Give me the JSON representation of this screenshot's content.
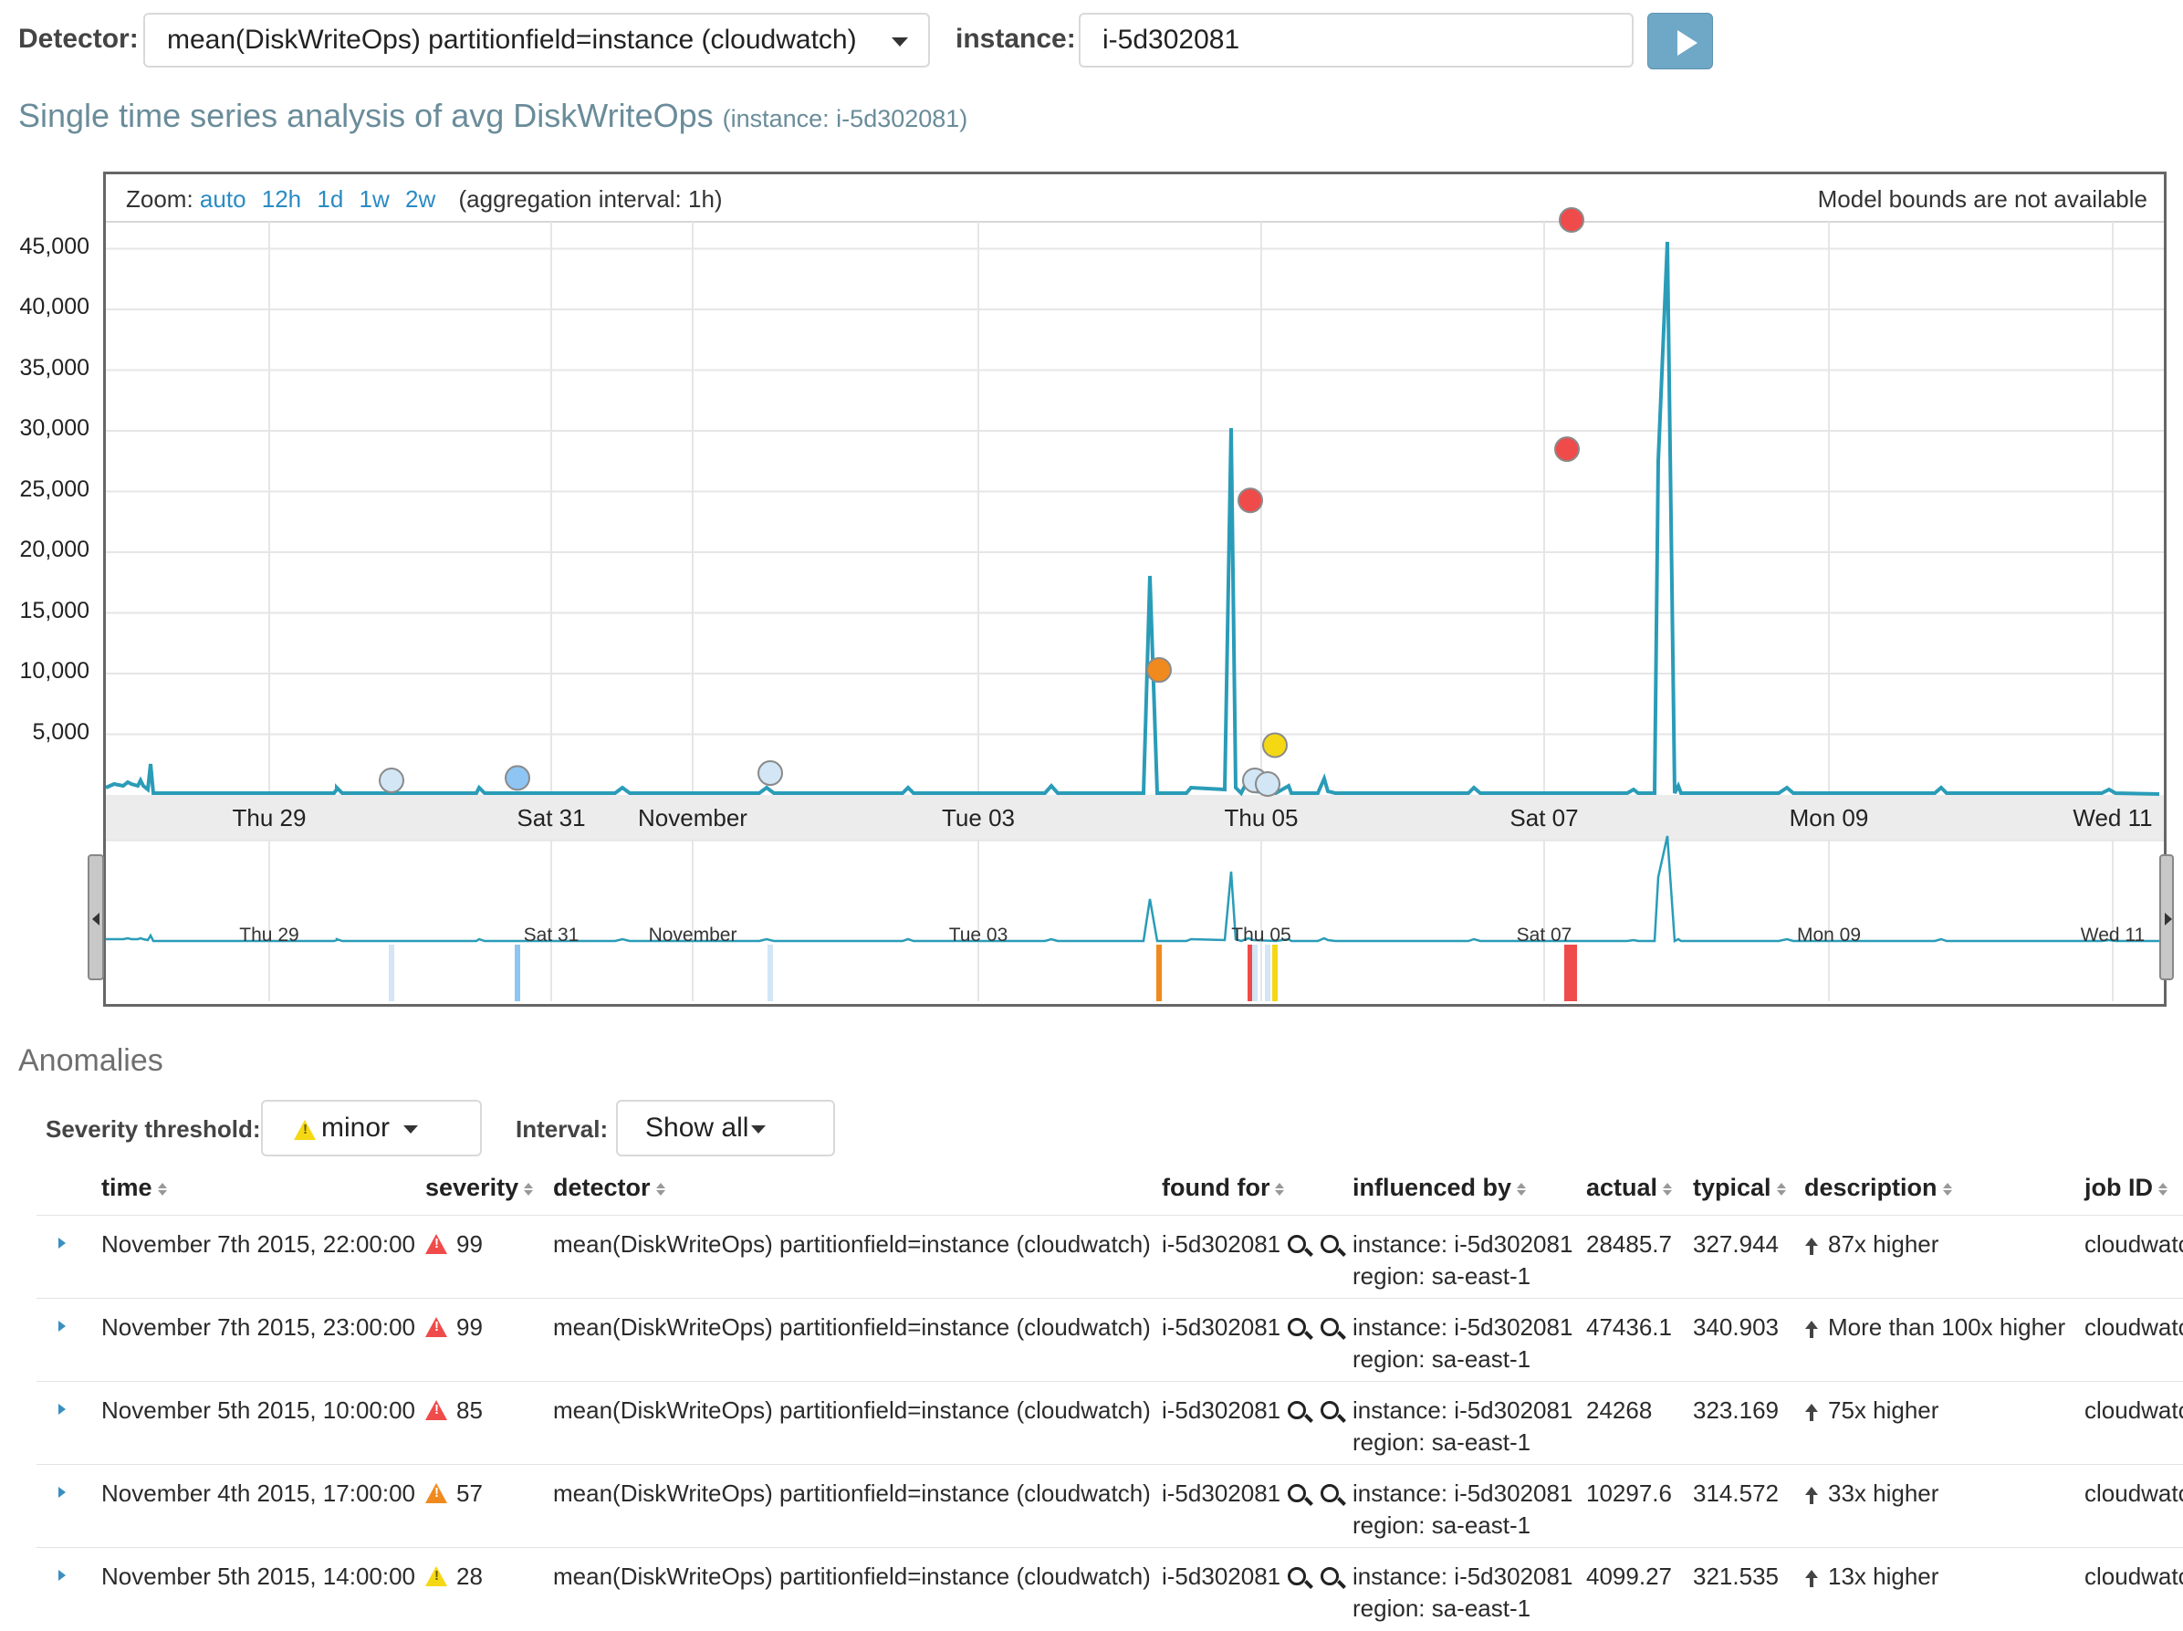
{
  "toolbar": {
    "detector_label": "Detector:",
    "detector_value": "mean(DiskWriteOps) partitionfield=instance (cloudwatch)",
    "instance_label": "instance:",
    "instance_value": "i-5d302081"
  },
  "title": {
    "main": "Single time series analysis of avg DiskWriteOps",
    "sub": "(instance: i-5d302081)"
  },
  "chart_header": {
    "zoom_label": "Zoom:",
    "zoom_options": [
      "auto",
      "12h",
      "1d",
      "1w",
      "2w"
    ],
    "aggregation": "(aggregation interval: 1h)",
    "model_bounds": "Model bounds are not available"
  },
  "colors": {
    "line": "#2a9cb8",
    "critical": "#f04b4b",
    "major": "#f08a1e",
    "minor": "#f5d814",
    "warning": "#8ec5f2",
    "low": "#d2e6f5",
    "link": "#2a8bc4"
  },
  "chart_data": {
    "type": "line",
    "ylim": [
      0,
      46000
    ],
    "yticks": [
      "5,000",
      "10,000",
      "15,000",
      "20,000",
      "25,000",
      "30,000",
      "35,000",
      "40,000",
      "45,000"
    ],
    "xticks": [
      "Thu 29",
      "Sat 31",
      "November",
      "Tue 03",
      "Thu 05",
      "Sat 07",
      "Mon 09",
      "Wed 11"
    ],
    "anomalies_markers": [
      {
        "x": 4.5,
        "y": 1200,
        "severity": "low"
      },
      {
        "x": 15.5,
        "y": 1400,
        "severity": "warning"
      },
      {
        "x": 36.0,
        "y": 1800,
        "severity": "low"
      },
      {
        "x": 59.0,
        "y": 10297.6,
        "severity": "major"
      },
      {
        "x": 64.0,
        "y": 24268,
        "severity": "critical"
      },
      {
        "x": 64.3,
        "y": 1200,
        "severity": "low"
      },
      {
        "x": 64.6,
        "y": 900,
        "severity": "low"
      },
      {
        "x": 65.0,
        "y": 4099.27,
        "severity": "minor"
      },
      {
        "x": 69.0,
        "y": 28485.7,
        "severity": "critical"
      },
      {
        "x": 70.0,
        "y": 47436.1,
        "severity": "critical"
      }
    ]
  },
  "anomalies": {
    "title": "Anomalies",
    "severity_label": "Severity threshold:",
    "severity_value": "minor",
    "interval_label": "Interval:",
    "interval_value": "Show all",
    "columns": [
      "time",
      "severity",
      "detector",
      "found for",
      "influenced by",
      "actual",
      "typical",
      "description",
      "job ID"
    ],
    "rows": [
      {
        "time": "November 7th 2015, 22:00:00",
        "severity": "99",
        "level": "critical",
        "detector": "mean(DiskWriteOps) partitionfield=instance (cloudwatch)",
        "found_for": "i-5d302081",
        "influenced_1": "instance: i-5d302081",
        "influenced_2": "region: sa-east-1",
        "actual": "28485.7",
        "typical": "327.944",
        "description": "87x higher",
        "job_id": "cloudwatch"
      },
      {
        "time": "November 7th 2015, 23:00:00",
        "severity": "99",
        "level": "critical",
        "detector": "mean(DiskWriteOps) partitionfield=instance (cloudwatch)",
        "found_for": "i-5d302081",
        "influenced_1": "instance: i-5d302081",
        "influenced_2": "region: sa-east-1",
        "actual": "47436.1",
        "typical": "340.903",
        "description": "More than 100x higher",
        "job_id": "cloudwatch"
      },
      {
        "time": "November 5th 2015, 10:00:00",
        "severity": "85",
        "level": "critical",
        "detector": "mean(DiskWriteOps) partitionfield=instance (cloudwatch)",
        "found_for": "i-5d302081",
        "influenced_1": "instance: i-5d302081",
        "influenced_2": "region: sa-east-1",
        "actual": "24268",
        "typical": "323.169",
        "description": "75x higher",
        "job_id": "cloudwatch"
      },
      {
        "time": "November 4th 2015, 17:00:00",
        "severity": "57",
        "level": "major",
        "detector": "mean(DiskWriteOps) partitionfield=instance (cloudwatch)",
        "found_for": "i-5d302081",
        "influenced_1": "instance: i-5d302081",
        "influenced_2": "region: sa-east-1",
        "actual": "10297.6",
        "typical": "314.572",
        "description": "33x higher",
        "job_id": "cloudwatch"
      },
      {
        "time": "November 5th 2015, 14:00:00",
        "severity": "28",
        "level": "minor",
        "detector": "mean(DiskWriteOps) partitionfield=instance (cloudwatch)",
        "found_for": "i-5d302081",
        "influenced_1": "instance: i-5d302081",
        "influenced_2": "region: sa-east-1",
        "actual": "4099.27",
        "typical": "321.535",
        "description": "13x higher",
        "job_id": "cloudwatch"
      }
    ]
  }
}
